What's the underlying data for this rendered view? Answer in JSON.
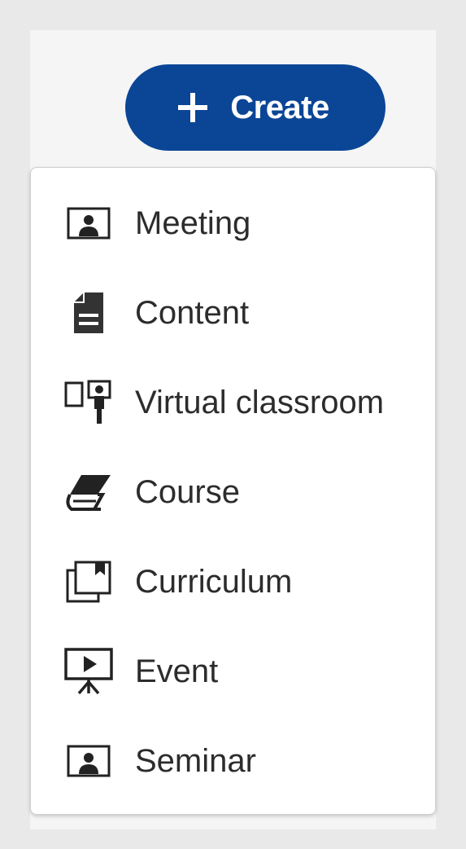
{
  "create_button": {
    "label": "Create",
    "icon": "plus-icon",
    "color": "#0b4696"
  },
  "menu": {
    "items": [
      {
        "label": "Meeting",
        "icon": "meeting-icon"
      },
      {
        "label": "Content",
        "icon": "content-icon"
      },
      {
        "label": "Virtual classroom",
        "icon": "virtual-classroom-icon"
      },
      {
        "label": "Course",
        "icon": "course-icon"
      },
      {
        "label": "Curriculum",
        "icon": "curriculum-icon"
      },
      {
        "label": "Event",
        "icon": "event-icon"
      },
      {
        "label": "Seminar",
        "icon": "seminar-icon"
      }
    ]
  }
}
